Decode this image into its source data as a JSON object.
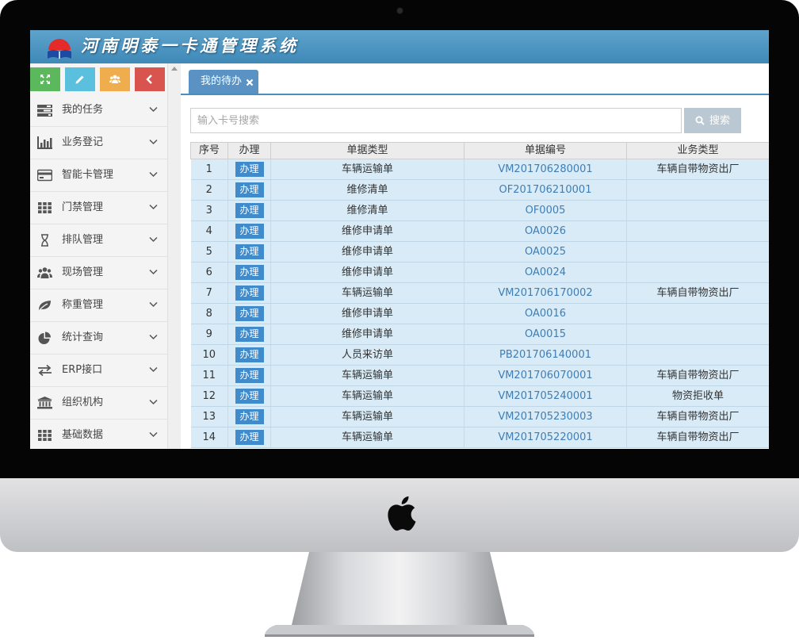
{
  "app": {
    "title": "河南明泰一卡通管理系统"
  },
  "shortcuts": [
    {
      "name": "shortcut-expand-button",
      "icon": "expand-icon",
      "color": "#5cb85c"
    },
    {
      "name": "shortcut-edit-button",
      "icon": "pencil-icon",
      "color": "#5bc0de"
    },
    {
      "name": "shortcut-users-button",
      "icon": "group-icon",
      "color": "#f0ad4e"
    },
    {
      "name": "shortcut-collapse-button",
      "icon": "chevron-left-icon",
      "color": "#d9534f"
    }
  ],
  "sidebar": {
    "items": [
      {
        "label": "我的任务",
        "icon": "tasks-icon"
      },
      {
        "label": "业务登记",
        "icon": "bar-chart-icon"
      },
      {
        "label": "智能卡管理",
        "icon": "credit-card-icon"
      },
      {
        "label": "门禁管理",
        "icon": "grid-icon"
      },
      {
        "label": "排队管理",
        "icon": "hourglass-icon"
      },
      {
        "label": "现场管理",
        "icon": "group-icon"
      },
      {
        "label": "称重管理",
        "icon": "leaf-icon"
      },
      {
        "label": "统计查询",
        "icon": "pie-chart-icon"
      },
      {
        "label": "ERP接口",
        "icon": "exchange-icon"
      },
      {
        "label": "组织机构",
        "icon": "institution-icon"
      },
      {
        "label": "基础数据",
        "icon": "grid-icon"
      }
    ]
  },
  "tabs": [
    {
      "label": "我的待办",
      "closable": true
    }
  ],
  "search": {
    "placeholder": "输入卡号搜索",
    "value": "",
    "button_label": "搜索"
  },
  "table": {
    "columns": [
      "序号",
      "办理",
      "单据类型",
      "单据编号",
      "业务类型"
    ],
    "action_label": "办理",
    "rows": [
      {
        "no": "1",
        "doc_type": "车辆运输单",
        "doc_no": "VM201706280001",
        "biz_type": "车辆自带物资出厂"
      },
      {
        "no": "2",
        "doc_type": "维修清单",
        "doc_no": "OF201706210001",
        "biz_type": ""
      },
      {
        "no": "3",
        "doc_type": "维修清单",
        "doc_no": "OF0005",
        "biz_type": ""
      },
      {
        "no": "4",
        "doc_type": "维修申请单",
        "doc_no": "OA0026",
        "biz_type": ""
      },
      {
        "no": "5",
        "doc_type": "维修申请单",
        "doc_no": "OA0025",
        "biz_type": ""
      },
      {
        "no": "6",
        "doc_type": "维修申请单",
        "doc_no": "OA0024",
        "biz_type": ""
      },
      {
        "no": "7",
        "doc_type": "车辆运输单",
        "doc_no": "VM201706170002",
        "biz_type": "车辆自带物资出厂"
      },
      {
        "no": "8",
        "doc_type": "维修申请单",
        "doc_no": "OA0016",
        "biz_type": ""
      },
      {
        "no": "9",
        "doc_type": "维修申请单",
        "doc_no": "OA0015",
        "biz_type": ""
      },
      {
        "no": "10",
        "doc_type": "人员来访单",
        "doc_no": "PB201706140001",
        "biz_type": ""
      },
      {
        "no": "11",
        "doc_type": "车辆运输单",
        "doc_no": "VM201706070001",
        "biz_type": "车辆自带物资出厂"
      },
      {
        "no": "12",
        "doc_type": "车辆运输单",
        "doc_no": "VM201705240001",
        "biz_type": "物资拒收单"
      },
      {
        "no": "13",
        "doc_type": "车辆运输单",
        "doc_no": "VM201705230003",
        "biz_type": "车辆自带物资出厂"
      },
      {
        "no": "14",
        "doc_type": "车辆运输单",
        "doc_no": "VM201705220001",
        "biz_type": "车辆自带物资出厂"
      }
    ]
  },
  "colors": {
    "header": "#4a92c0",
    "tab": "#5a93c3",
    "row_bg": "#d9ebf6",
    "link": "#3e7eb5",
    "action_button": "#428bca",
    "search_button": "#b9c8d2"
  }
}
